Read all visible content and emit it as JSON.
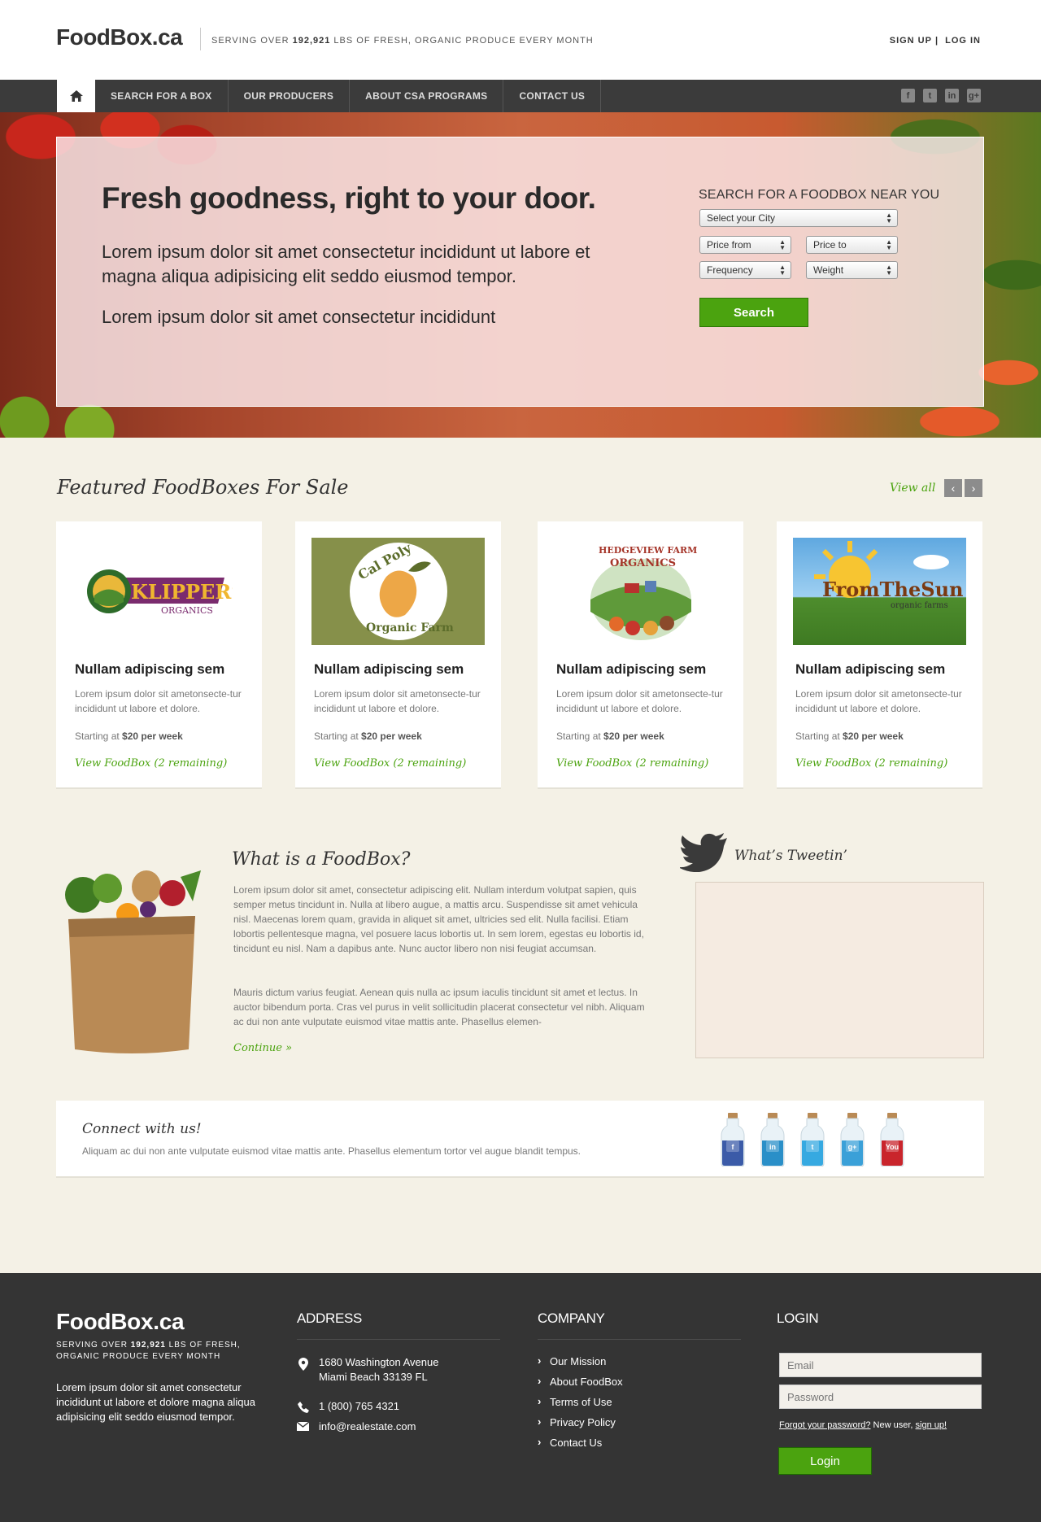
{
  "header": {
    "logo": "FoodBox.ca",
    "tagline_pre": "SERVING OVER ",
    "tagline_num": "192,921",
    "tagline_post": " LBS OF FRESH, ORGANIC PRODUCE EVERY MONTH",
    "signup": "SIGN UP",
    "sep": "|",
    "login": "LOG IN"
  },
  "nav": {
    "items": [
      "SEARCH FOR A BOX",
      "OUR PRODUCERS",
      "ABOUT CSA PROGRAMS",
      "CONTACT US"
    ],
    "social": [
      {
        "icon": "facebook-icon",
        "glyph": "f"
      },
      {
        "icon": "twitter-icon",
        "glyph": "t"
      },
      {
        "icon": "linkedin-icon",
        "glyph": "in"
      },
      {
        "icon": "googleplus-icon",
        "glyph": "g+"
      }
    ]
  },
  "hero": {
    "title": "Fresh goodness, right to your door.",
    "p1": "Lorem ipsum dolor sit amet consectetur incididunt ut labore et magna aliqua adipisicing elit seddo eiusmod tempor.",
    "p2": "Lorem ipsum dolor sit amet consectetur incididunt",
    "search_title": "SEARCH FOR A FOODBOX NEAR YOU",
    "city": "Select your City",
    "price_from": "Price from",
    "price_to": "Price to",
    "frequency": "Frequency",
    "weight": "Weight",
    "search_button": "Search"
  },
  "featured": {
    "title": "Featured FoodBoxes For Sale",
    "view_all": "View all",
    "cards": [
      {
        "logo": "KLIPPERS",
        "logo_sub": "ORGANICS",
        "title": "Nullam adipiscing sem",
        "desc": "Lorem ipsum dolor sit ametonsecte-tur incididunt ut labore et dolore.",
        "price_pre": "Starting at ",
        "price": "$20 per week",
        "link": "View FoodBox (2 remaining)"
      },
      {
        "logo": "Cal Poly",
        "logo_sub": "Organic Farm",
        "title": "Nullam adipiscing sem",
        "desc": "Lorem ipsum dolor sit ametonsecte-tur incididunt ut labore et dolore.",
        "price_pre": "Starting at ",
        "price": "$20 per week",
        "link": "View FoodBox (2 remaining)"
      },
      {
        "logo": "HEDGEVIEW FARM",
        "logo_sub": "ORGANICS",
        "title": "Nullam adipiscing sem",
        "desc": "Lorem ipsum dolor sit ametonsecte-tur incididunt ut labore et dolore.",
        "price_pre": "Starting at ",
        "price": "$20 per week",
        "link": "View FoodBox (2 remaining)"
      },
      {
        "logo": "FromTheSun",
        "logo_sub": "organic farms",
        "title": "Nullam adipiscing sem",
        "desc": "Lorem ipsum dolor sit ametonsecte-tur incididunt ut labore et dolore.",
        "price_pre": "Starting at ",
        "price": "$20 per week",
        "link": "View FoodBox (2 remaining)"
      }
    ]
  },
  "about": {
    "title": "What is a FoodBox?",
    "p1": "Lorem ipsum dolor sit amet, consectetur adipiscing elit. Nullam interdum volutpat sapien, quis semper metus tincidunt in. Nulla at libero augue, a mattis arcu. Suspendisse sit amet vehicula nisl. Maecenas lorem quam, gravida in aliquet sit amet, ultricies sed elit. Nulla facilisi. Etiam lobortis pellentesque magna, vel posuere lacus lobortis ut. In sem lorem, egestas eu lobortis id, tincidunt eu nisl. Nam a dapibus ante. Nunc auctor libero non nisi feugiat accumsan.",
    "p2": "Mauris dictum varius feugiat. Aenean quis nulla ac ipsum iaculis tincidunt sit amet et lectus. In auctor bibendum porta. Cras vel purus in velit sollicitudin placerat consectetur vel nibh. Aliquam ac dui non ante vulputate euismod vitae mattis ante. Phasellus elemen-",
    "continue": "Continue  »"
  },
  "tweets": {
    "title": "What’s Tweetin’"
  },
  "connect": {
    "title": "Connect with us!",
    "text": "Aliquam ac dui non ante vulputate euismod vitae mattis ante. Phasellus elementum tortor vel augue blandit tempus.",
    "bottles": [
      {
        "icon": "facebook-bottle-icon",
        "color": "#3b5ba8",
        "glyph": "f"
      },
      {
        "icon": "linkedin-bottle-icon",
        "color": "#2a8fc8",
        "glyph": "in"
      },
      {
        "icon": "twitter-bottle-icon",
        "color": "#36a9e1",
        "glyph": "t"
      },
      {
        "icon": "googleplus-bottle-icon",
        "color": "#3aa0d8",
        "glyph": "g+"
      },
      {
        "icon": "youtube-bottle-icon",
        "color": "#c9252c",
        "glyph": "You"
      }
    ]
  },
  "footer": {
    "logo": "FoodBox.ca",
    "tag_pre": "SERVING OVER ",
    "tag_num": "192,921",
    "tag_post": " LBS OF FRESH, ORGANIC PRODUCE EVERY MONTH",
    "desc": "Lorem ipsum dolor sit amet consectetur incididunt ut labore et dolore magna aliqua adipisicing elit seddo eiusmod tempor.",
    "address_title": "ADDRESS",
    "address_line1": "1680 Washington Avenue",
    "address_line2": "Miami Beach 33139 FL",
    "phone": "1 (800) 765 4321",
    "email": "info@realestate.com",
    "company_title": "COMPANY",
    "company_links": [
      "Our Mission",
      "About FoodBox",
      "Terms of Use",
      "Privacy Policy",
      "Contact Us"
    ],
    "login_title": "LOGIN",
    "email_placeholder": "Email",
    "password_placeholder": "Password",
    "forgot": "Forgot your password?",
    "new_user": " New user, ",
    "signup": "sign up!",
    "login_button": "Login"
  }
}
